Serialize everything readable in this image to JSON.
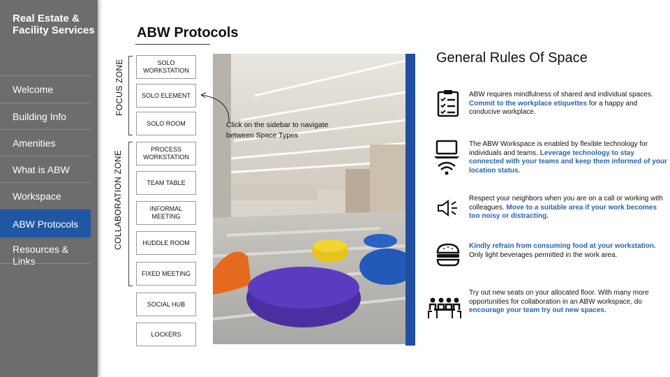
{
  "sidebar": {
    "brand": "Real Estate & Facility Services",
    "items": [
      {
        "label": "Welcome"
      },
      {
        "label": "Building Info"
      },
      {
        "label": "Amenities"
      },
      {
        "label": "What is ABW"
      },
      {
        "label": "Workspace"
      },
      {
        "label": "ABW Protocols",
        "active": true
      },
      {
        "label": "Resources & Links"
      }
    ],
    "active_color": "#1f57a5",
    "background_color": "#6d6d6d"
  },
  "page": {
    "title": "ABW Protocols"
  },
  "zones": {
    "focus": "FOCUS ZONE",
    "collaboration": "COLLABORATION ZONE"
  },
  "space_types": [
    {
      "label": "SOLO WORKSTATION"
    },
    {
      "label": "SOLO ELEMENT"
    },
    {
      "label": "SOLO ROOM"
    },
    {
      "label": "PROCESS WORKSTATION"
    },
    {
      "label": "TEAM TABLE"
    },
    {
      "label": "INFORMAL MEETING"
    },
    {
      "label": "HUDDLE ROOM"
    },
    {
      "label": "FIXED MEETING"
    },
    {
      "label": "SOCIAL HUB"
    },
    {
      "label": "LOCKERS"
    }
  ],
  "hint": {
    "text": "Click on the sidebar to navigate between Space Types"
  },
  "rules": {
    "title": "General Rules Of Space",
    "highlight_color": "#2a64ad",
    "items": [
      {
        "icon": "clipboard-checklist-icon",
        "before": "ABW requires mindfulness of shared and individual spaces. ",
        "highlight": "Commit to the workplace etiquettes",
        "after": " for a happy and conducive workplace."
      },
      {
        "icon": "laptop-wifi-icon",
        "before": "The ABW Workspace is enabled by flexible technology for individuals and teams. ",
        "highlight": "Leverage technology to stay connected with your teams and keep them informed of your location status.",
        "after": ""
      },
      {
        "icon": "speaker-icon",
        "before": "Respect your neighbors when you are on a call or working with colleagues. ",
        "highlight": "Move to a suitable area if your work becomes too noisy or distracting.",
        "after": ""
      },
      {
        "icon": "burger-icon",
        "before": "",
        "highlight": "Kindly refrain from consuming food at your workstation.",
        "after": " Only light beverages permitted in the work area."
      },
      {
        "icon": "team-meeting-icon",
        "before": "Try out new seats on your allocated floor. With many more opportunities for collaboration in an ABW workspace, do ",
        "highlight": "encourage your team try out new spaces.",
        "after": ""
      }
    ]
  }
}
